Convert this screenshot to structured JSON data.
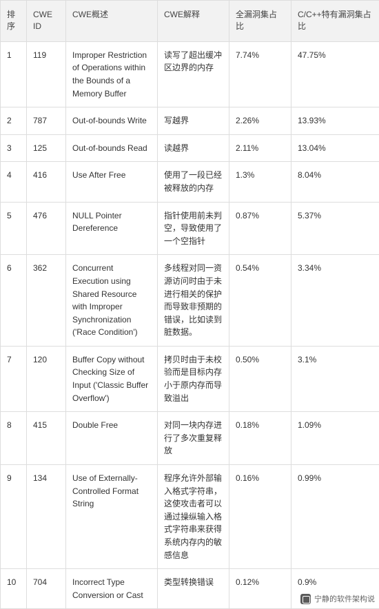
{
  "table": {
    "columns": [
      {
        "key": "rank",
        "label": "排序"
      },
      {
        "key": "id",
        "label": "CWE ID"
      },
      {
        "key": "desc",
        "label": "CWE概述"
      },
      {
        "key": "expl",
        "label": "CWE解释"
      },
      {
        "key": "all",
        "label": "全漏洞集占比"
      },
      {
        "key": "cpp",
        "label": "C/C++特有漏洞集占比"
      }
    ],
    "rows": [
      {
        "rank": "1",
        "id": "119",
        "desc": "Improper Restriction of Operations within the Bounds of a Memory Buffer",
        "expl": "读写了超出缓冲区边界的内存",
        "all": "7.74%",
        "cpp": "47.75%"
      },
      {
        "rank": "2",
        "id": "787",
        "desc": "Out-of-bounds Write",
        "expl": "写越界",
        "all": "2.26%",
        "cpp": "13.93%"
      },
      {
        "rank": "3",
        "id": "125",
        "desc": "Out-of-bounds Read",
        "expl": "读越界",
        "all": "2.11%",
        "cpp": "13.04%"
      },
      {
        "rank": "4",
        "id": "416",
        "desc": "Use After Free",
        "expl": "使用了一段已经被释放的内存",
        "all": "1.3%",
        "cpp": "8.04%"
      },
      {
        "rank": "5",
        "id": "476",
        "desc": "NULL Pointer Dereference",
        "expl": "指针使用前未判空，导致使用了一个空指针",
        "all": "0.87%",
        "cpp": "5.37%"
      },
      {
        "rank": "6",
        "id": "362",
        "desc": "Concurrent Execution using Shared Resource with Improper Synchronization ('Race Condition')",
        "expl": "多线程对同一资源访问时由于未进行相关的保护而导致非预期的错误，比如读到脏数据。",
        "all": "0.54%",
        "cpp": "3.34%"
      },
      {
        "rank": "7",
        "id": "120",
        "desc": "Buffer Copy without Checking Size of Input ('Classic Buffer Overflow')",
        "expl": "拷贝时由于未校验而是目标内存小于原内存而导致溢出",
        "all": "0.50%",
        "cpp": "3.1%"
      },
      {
        "rank": "8",
        "id": "415",
        "desc": "Double Free",
        "expl": "对同一块内存进行了多次重复释放",
        "all": "0.18%",
        "cpp": "1.09%"
      },
      {
        "rank": "9",
        "id": "134",
        "desc": "Use of Externally-Controlled Format String",
        "expl": "程序允许外部输入格式字符串，这使攻击者可以通过操纵输入格式字符串来获得系统内存内的敏感信息",
        "all": "0.16%",
        "cpp": "0.99%"
      },
      {
        "rank": "10",
        "id": "704",
        "desc": "Incorrect Type Conversion or Cast",
        "expl": "类型转换错误",
        "all": "0.12%",
        "cpp": "0.9%"
      }
    ]
  },
  "watermark": {
    "text": "宁静的软件架构说"
  }
}
